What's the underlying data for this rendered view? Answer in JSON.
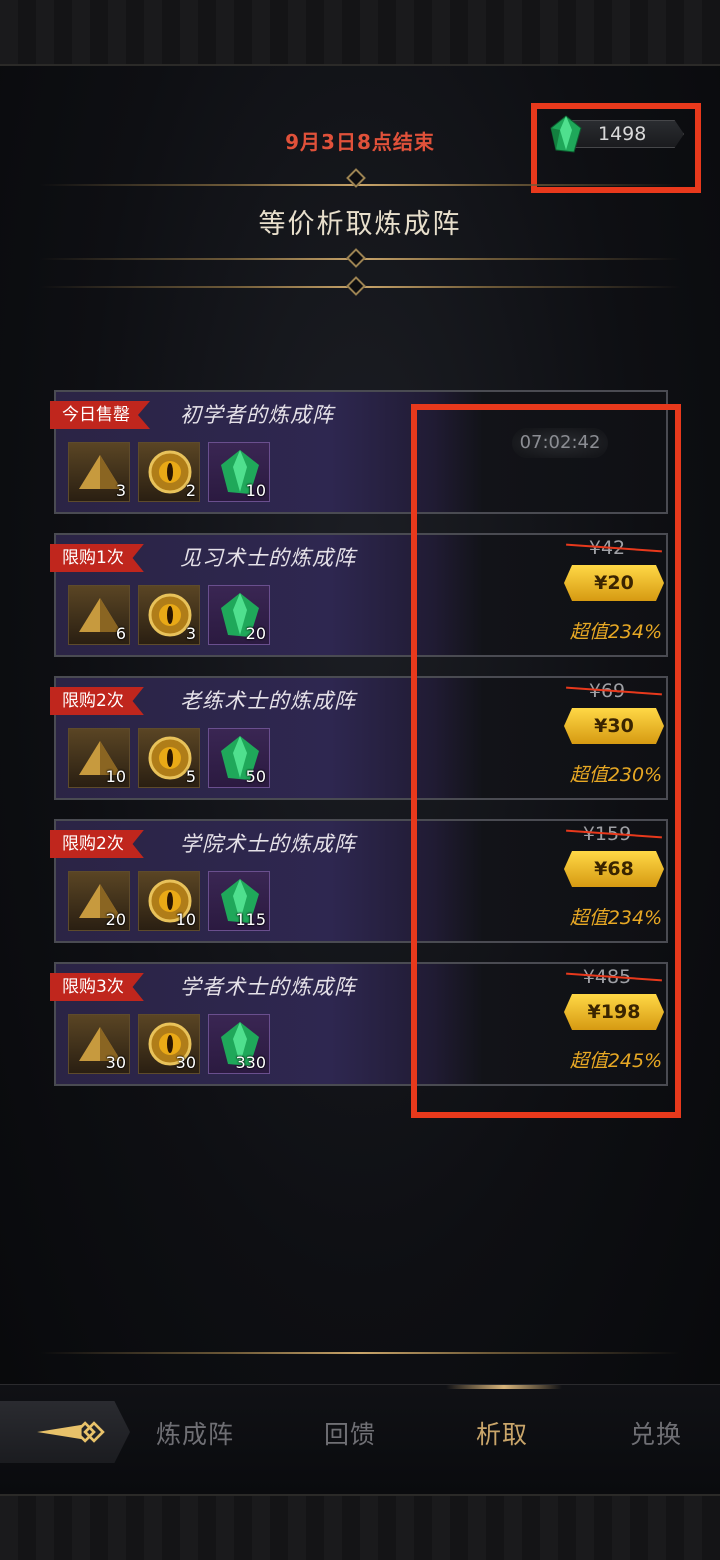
{
  "header": {
    "end_time": "9月3日8点结束",
    "currency": {
      "icon": "green-gem-icon",
      "amount": "1498"
    },
    "title": "等价析取炼成阵"
  },
  "packs": [
    {
      "tag": "今日售罄",
      "name": "初学者的炼成阵",
      "items": [
        {
          "icon": "gold-pyramid-icon",
          "count": "3"
        },
        {
          "icon": "golden-eye-orb-icon",
          "count": "2"
        },
        {
          "icon": "green-gem-icon",
          "count": "10"
        }
      ],
      "timer": "07:02:42"
    },
    {
      "tag": "限购1次",
      "name": "见习术士的炼成阵",
      "items": [
        {
          "icon": "gold-pyramid-icon",
          "count": "6"
        },
        {
          "icon": "golden-eye-orb-icon",
          "count": "3"
        },
        {
          "icon": "green-gem-icon",
          "count": "20"
        }
      ],
      "old_price": "¥42",
      "price": "¥20",
      "value": "超值234%"
    },
    {
      "tag": "限购2次",
      "name": "老练术士的炼成阵",
      "items": [
        {
          "icon": "gold-pyramid-icon",
          "count": "10"
        },
        {
          "icon": "golden-eye-orb-icon",
          "count": "5"
        },
        {
          "icon": "green-gem-icon",
          "count": "50"
        }
      ],
      "old_price": "¥69",
      "price": "¥30",
      "value": "超值230%"
    },
    {
      "tag": "限购2次",
      "name": "学院术士的炼成阵",
      "items": [
        {
          "icon": "gold-pyramid-icon",
          "count": "20"
        },
        {
          "icon": "golden-eye-orb-icon",
          "count": "10"
        },
        {
          "icon": "green-gem-icon",
          "count": "115"
        }
      ],
      "old_price": "¥159",
      "price": "¥68",
      "value": "超值234%"
    },
    {
      "tag": "限购3次",
      "name": "学者术士的炼成阵",
      "items": [
        {
          "icon": "gold-pyramid-icon",
          "count": "30"
        },
        {
          "icon": "golden-eye-orb-icon",
          "count": "30"
        },
        {
          "icon": "green-gem-icon",
          "count": "330"
        }
      ],
      "old_price": "¥485",
      "price": "¥198",
      "value": "超值245%"
    }
  ],
  "tabs": [
    {
      "label": "炼成阵",
      "active": false
    },
    {
      "label": "回馈",
      "active": false
    },
    {
      "label": "析取",
      "active": true
    },
    {
      "label": "兑换",
      "active": false
    }
  ],
  "colors": {
    "accent_red": "#e8391c",
    "price_gold": "#ffd846",
    "value_orange": "#e7a824",
    "tab_active": "#c9a56a"
  }
}
